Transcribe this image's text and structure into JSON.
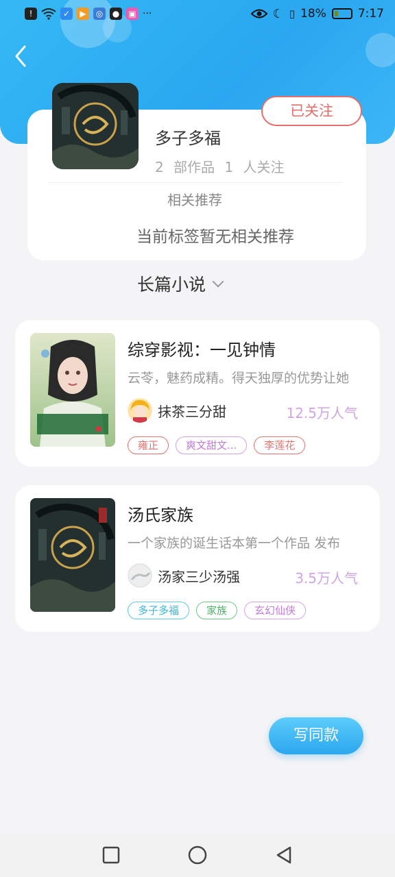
{
  "status_bar": {
    "battery_percent": "18%",
    "time": "7:17",
    "more": "···"
  },
  "tag_profile": {
    "name": "多子多福",
    "works": "2 部作品",
    "followers": "1 人关注",
    "follow_button": "已关注",
    "related_title": "相关推荐",
    "no_related": "当前标签暂无相关推荐"
  },
  "section": {
    "category": "长篇小说"
  },
  "books": [
    {
      "title": "综穿影视：一见钟情",
      "desc": "云苓，魅药成精。得天独厚的优势让她",
      "author": "抹茶三分甜",
      "popularity": "12.5万人气",
      "tags": [
        "雍正",
        "爽文甜文...",
        "李莲花"
      ]
    },
    {
      "title": "汤氏家族",
      "desc": "一个家族的诞生话本第一个作品 发布",
      "author": "汤家三少汤强",
      "popularity": "3.5万人气",
      "tags": [
        "多子多福",
        "家族",
        "玄幻仙侠"
      ]
    }
  ],
  "actions": {
    "write_same": "写同款"
  },
  "icons": {
    "back": "back-arrow-icon",
    "chevron": "chevron-down-icon",
    "nav_recent": "square-icon",
    "nav_home": "circle-icon",
    "nav_back": "triangle-back-icon"
  },
  "colors": {
    "header": "#2aa7f0",
    "follow_red": "#e56e6a",
    "popularity_purple": "#cfa3e6"
  }
}
